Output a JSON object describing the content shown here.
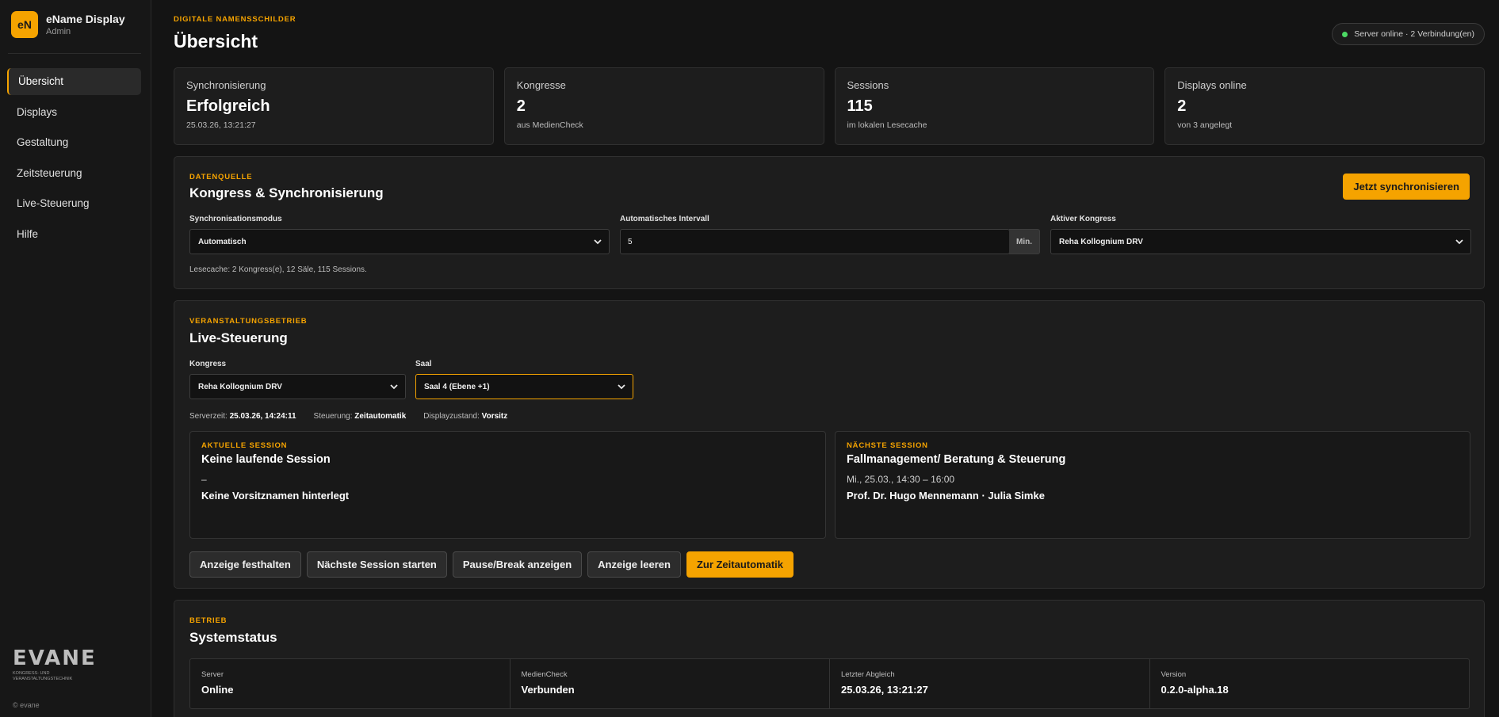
{
  "brand": {
    "logo": "eN",
    "name": "eName Display",
    "role": "Admin"
  },
  "nav": {
    "items": [
      {
        "label": "Übersicht"
      },
      {
        "label": "Displays"
      },
      {
        "label": "Gestaltung"
      },
      {
        "label": "Zeitsteuerung"
      },
      {
        "label": "Live-Steuerung"
      },
      {
        "label": "Hilfe"
      }
    ],
    "active_index": 0
  },
  "footer": {
    "logo_word": "EVANE",
    "logo_tagline": "KONGRESS- UND VERANSTALTUNGSTECHNIK",
    "copyright": "© evane"
  },
  "header": {
    "eyebrow": "DIGITALE NAMENSSCHILDER",
    "title": "Übersicht",
    "server_status": "Server online · 2 Verbindung(en)",
    "status_color": "#4cd964"
  },
  "stats": [
    {
      "label": "Synchronisierung",
      "value": "Erfolgreich",
      "sub": "25.03.26, 13:21:27"
    },
    {
      "label": "Kongresse",
      "value": "2",
      "sub": "aus MedienCheck"
    },
    {
      "label": "Sessions",
      "value": "115",
      "sub": "im lokalen Lesecache"
    },
    {
      "label": "Displays online",
      "value": "2",
      "sub": "von 3 angelegt"
    }
  ],
  "sync": {
    "eyebrow": "DATENQUELLE",
    "title": "Kongress & Synchronisierung",
    "sync_button": "Jetzt synchronisieren",
    "mode_label": "Synchronisationsmodus",
    "mode_value": "Automatisch",
    "interval_label": "Automatisches Intervall",
    "interval_value": "5",
    "interval_unit": "Min.",
    "congress_label": "Aktiver Kongress",
    "congress_value": "Reha Kollognium DRV",
    "cache_note": "Lesecache: 2 Kongress(e), 12 Säle, 115 Sessions."
  },
  "live": {
    "eyebrow": "VERANSTALTUNGSBETRIEB",
    "title": "Live-Steuerung",
    "congress_label": "Kongress",
    "congress_value": "Reha Kollognium DRV",
    "room_label": "Saal",
    "room_value": "Saal 4 (Ebene +1)",
    "server_time_label": "Serverzeit:",
    "server_time": "25.03.26, 14:24:11",
    "control_label": "Steuerung:",
    "control_value": "Zeitautomatik",
    "display_state_label": "Displayzustand:",
    "display_state_value": "Vorsitz",
    "current": {
      "eyebrow": "AKTUELLE SESSION",
      "title": "Keine laufende Session",
      "time": "–",
      "names": "Keine Vorsitznamen hinterlegt"
    },
    "next": {
      "eyebrow": "NÄCHSTE SESSION",
      "title": "Fallmanagement/ Beratung & Steuerung",
      "time": "Mi., 25.03., 14:30 – 16:00",
      "names": "Prof. Dr. Hugo Mennemann · Julia Simke"
    },
    "buttons": {
      "hold": "Anzeige festhalten",
      "next_session": "Nächste Session starten",
      "pause": "Pause/Break anzeigen",
      "clear": "Anzeige leeren",
      "auto": "Zur Zeitautomatik"
    }
  },
  "system": {
    "eyebrow": "BETRIEB",
    "title": "Systemstatus",
    "cells": [
      {
        "label": "Server",
        "value": "Online"
      },
      {
        "label": "MedienCheck",
        "value": "Verbunden"
      },
      {
        "label": "Letzter Abgleich",
        "value": "25.03.26, 13:21:27"
      },
      {
        "label": "Version",
        "value": "0.2.0-alpha.18"
      }
    ]
  },
  "colors": {
    "accent": "#f5a300",
    "background": "#141414",
    "card": "#1d1d1d"
  }
}
